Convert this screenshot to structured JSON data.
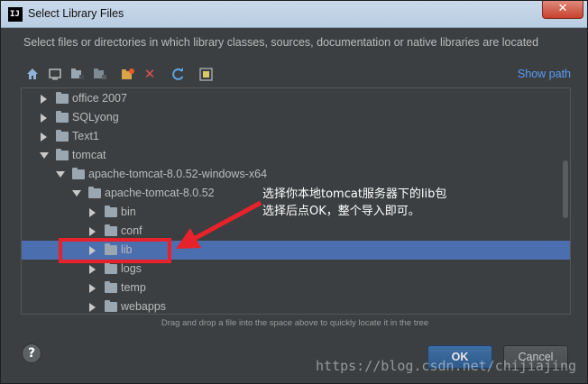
{
  "window": {
    "title": "Select Library Files",
    "app_icon_text": "IJ",
    "close_glyph": "✕",
    "description": "Select files or directories in which library classes, sources, documentation or native libraries are located"
  },
  "toolbar": {
    "icons": [
      "home-icon",
      "desktop-icon",
      "project-folder-icon",
      "module-folder-icon",
      "new-folder-icon",
      "delete-icon",
      "refresh-icon",
      "toggle-hidden-icon"
    ],
    "show_path_label": "Show path"
  },
  "tree": {
    "rows": [
      {
        "label": "office 2007",
        "expanded": false
      },
      {
        "label": "SQLyong",
        "expanded": false
      },
      {
        "label": "Text1",
        "expanded": false
      },
      {
        "label": "tomcat",
        "expanded": true
      },
      {
        "label": "apache-tomcat-8.0.52-windows-x64",
        "expanded": true
      },
      {
        "label": "apache-tomcat-8.0.52",
        "expanded": true
      },
      {
        "label": "bin",
        "expanded": false
      },
      {
        "label": "conf",
        "expanded": false
      },
      {
        "label": "lib",
        "expanded": false,
        "selected": true
      },
      {
        "label": "logs",
        "expanded": false
      },
      {
        "label": "temp",
        "expanded": false
      },
      {
        "label": "webapps",
        "expanded": false
      }
    ]
  },
  "annotation": {
    "line1": "选择你本地tomcat服务器下的lib包",
    "line2": "选择后点OK，整个导入即可。",
    "color": "#e8222a"
  },
  "hint": "Drag and drop a file into the space above to quickly locate it in the tree",
  "buttons": {
    "help": "?",
    "ok": "OK",
    "cancel": "Cancel"
  },
  "watermark": "https://blog.csdn.net/chijiajing",
  "colors": {
    "background": "#3c3f41",
    "selection": "#4b6eaf",
    "link": "#589df6"
  }
}
